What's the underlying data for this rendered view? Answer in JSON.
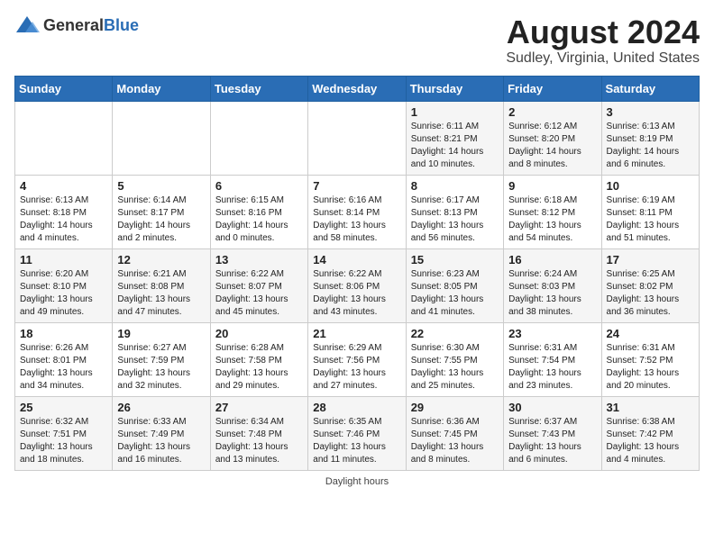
{
  "logo": {
    "general": "General",
    "blue": "Blue"
  },
  "header": {
    "month_year": "August 2024",
    "location": "Sudley, Virginia, United States"
  },
  "days_of_week": [
    "Sunday",
    "Monday",
    "Tuesday",
    "Wednesday",
    "Thursday",
    "Friday",
    "Saturday"
  ],
  "footer": {
    "daylight_label": "Daylight hours"
  },
  "weeks": [
    [
      {
        "day": "",
        "info": ""
      },
      {
        "day": "",
        "info": ""
      },
      {
        "day": "",
        "info": ""
      },
      {
        "day": "",
        "info": ""
      },
      {
        "day": "1",
        "info": "Sunrise: 6:11 AM\nSunset: 8:21 PM\nDaylight: 14 hours\nand 10 minutes."
      },
      {
        "day": "2",
        "info": "Sunrise: 6:12 AM\nSunset: 8:20 PM\nDaylight: 14 hours\nand 8 minutes."
      },
      {
        "day": "3",
        "info": "Sunrise: 6:13 AM\nSunset: 8:19 PM\nDaylight: 14 hours\nand 6 minutes."
      }
    ],
    [
      {
        "day": "4",
        "info": "Sunrise: 6:13 AM\nSunset: 8:18 PM\nDaylight: 14 hours\nand 4 minutes."
      },
      {
        "day": "5",
        "info": "Sunrise: 6:14 AM\nSunset: 8:17 PM\nDaylight: 14 hours\nand 2 minutes."
      },
      {
        "day": "6",
        "info": "Sunrise: 6:15 AM\nSunset: 8:16 PM\nDaylight: 14 hours\nand 0 minutes."
      },
      {
        "day": "7",
        "info": "Sunrise: 6:16 AM\nSunset: 8:14 PM\nDaylight: 13 hours\nand 58 minutes."
      },
      {
        "day": "8",
        "info": "Sunrise: 6:17 AM\nSunset: 8:13 PM\nDaylight: 13 hours\nand 56 minutes."
      },
      {
        "day": "9",
        "info": "Sunrise: 6:18 AM\nSunset: 8:12 PM\nDaylight: 13 hours\nand 54 minutes."
      },
      {
        "day": "10",
        "info": "Sunrise: 6:19 AM\nSunset: 8:11 PM\nDaylight: 13 hours\nand 51 minutes."
      }
    ],
    [
      {
        "day": "11",
        "info": "Sunrise: 6:20 AM\nSunset: 8:10 PM\nDaylight: 13 hours\nand 49 minutes."
      },
      {
        "day": "12",
        "info": "Sunrise: 6:21 AM\nSunset: 8:08 PM\nDaylight: 13 hours\nand 47 minutes."
      },
      {
        "day": "13",
        "info": "Sunrise: 6:22 AM\nSunset: 8:07 PM\nDaylight: 13 hours\nand 45 minutes."
      },
      {
        "day": "14",
        "info": "Sunrise: 6:22 AM\nSunset: 8:06 PM\nDaylight: 13 hours\nand 43 minutes."
      },
      {
        "day": "15",
        "info": "Sunrise: 6:23 AM\nSunset: 8:05 PM\nDaylight: 13 hours\nand 41 minutes."
      },
      {
        "day": "16",
        "info": "Sunrise: 6:24 AM\nSunset: 8:03 PM\nDaylight: 13 hours\nand 38 minutes."
      },
      {
        "day": "17",
        "info": "Sunrise: 6:25 AM\nSunset: 8:02 PM\nDaylight: 13 hours\nand 36 minutes."
      }
    ],
    [
      {
        "day": "18",
        "info": "Sunrise: 6:26 AM\nSunset: 8:01 PM\nDaylight: 13 hours\nand 34 minutes."
      },
      {
        "day": "19",
        "info": "Sunrise: 6:27 AM\nSunset: 7:59 PM\nDaylight: 13 hours\nand 32 minutes."
      },
      {
        "day": "20",
        "info": "Sunrise: 6:28 AM\nSunset: 7:58 PM\nDaylight: 13 hours\nand 29 minutes."
      },
      {
        "day": "21",
        "info": "Sunrise: 6:29 AM\nSunset: 7:56 PM\nDaylight: 13 hours\nand 27 minutes."
      },
      {
        "day": "22",
        "info": "Sunrise: 6:30 AM\nSunset: 7:55 PM\nDaylight: 13 hours\nand 25 minutes."
      },
      {
        "day": "23",
        "info": "Sunrise: 6:31 AM\nSunset: 7:54 PM\nDaylight: 13 hours\nand 23 minutes."
      },
      {
        "day": "24",
        "info": "Sunrise: 6:31 AM\nSunset: 7:52 PM\nDaylight: 13 hours\nand 20 minutes."
      }
    ],
    [
      {
        "day": "25",
        "info": "Sunrise: 6:32 AM\nSunset: 7:51 PM\nDaylight: 13 hours\nand 18 minutes."
      },
      {
        "day": "26",
        "info": "Sunrise: 6:33 AM\nSunset: 7:49 PM\nDaylight: 13 hours\nand 16 minutes."
      },
      {
        "day": "27",
        "info": "Sunrise: 6:34 AM\nSunset: 7:48 PM\nDaylight: 13 hours\nand 13 minutes."
      },
      {
        "day": "28",
        "info": "Sunrise: 6:35 AM\nSunset: 7:46 PM\nDaylight: 13 hours\nand 11 minutes."
      },
      {
        "day": "29",
        "info": "Sunrise: 6:36 AM\nSunset: 7:45 PM\nDaylight: 13 hours\nand 8 minutes."
      },
      {
        "day": "30",
        "info": "Sunrise: 6:37 AM\nSunset: 7:43 PM\nDaylight: 13 hours\nand 6 minutes."
      },
      {
        "day": "31",
        "info": "Sunrise: 6:38 AM\nSunset: 7:42 PM\nDaylight: 13 hours\nand 4 minutes."
      }
    ]
  ]
}
